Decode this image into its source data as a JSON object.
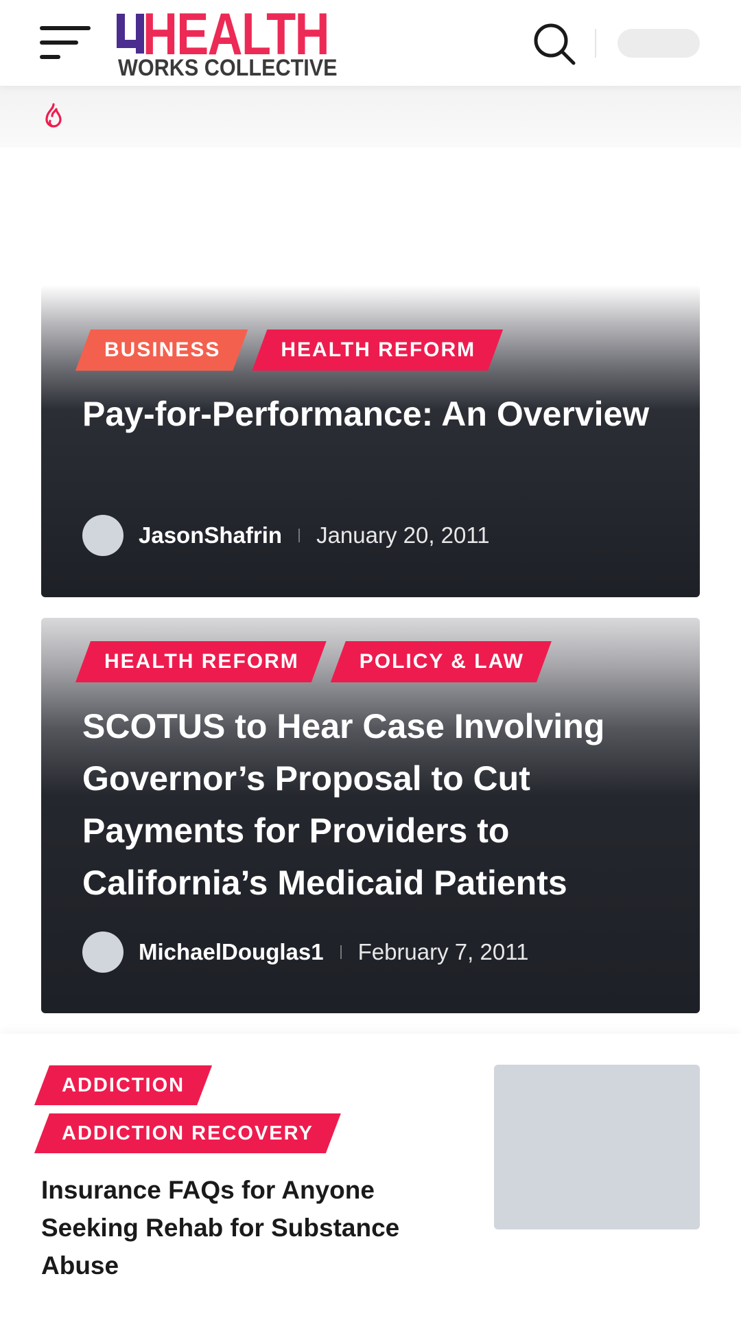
{
  "header": {
    "logo_top": "HEALTH",
    "logo_bottom": "WORKS COLLECTIVE",
    "brand_color": "#ec2a55"
  },
  "icons": {
    "menu": "hamburger-menu-icon",
    "search": "search-icon",
    "trending": "flame-icon"
  },
  "colors": {
    "tag_business": "#f4604e",
    "tag_pink": "#ee1c4e",
    "card_dark": "#1e2027",
    "placeholder": "#d1d5dc"
  },
  "featured": [
    {
      "tags": [
        "BUSINESS",
        "HEALTH REFORM"
      ],
      "title": "Pay-for-Performance: An Overview",
      "author": "JasonShafrin",
      "date": "January 20, 2011"
    },
    {
      "tags": [
        "HEALTH REFORM",
        "POLICY & LAW"
      ],
      "title": "SCOTUS to Hear Case Involving Governor’s Proposal to Cut Payments for Providers to California’s Medicaid Patients",
      "author": "MichaelDouglas1",
      "date": "February 7, 2011"
    }
  ],
  "list": [
    {
      "tags": [
        "ADDICTION",
        "ADDICTION RECOVERY"
      ],
      "title": "Insurance FAQs for Anyone Seeking Rehab for Substance Abuse"
    }
  ]
}
